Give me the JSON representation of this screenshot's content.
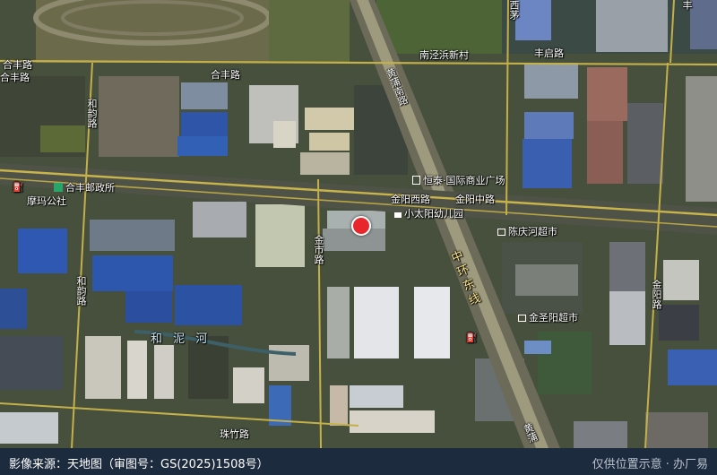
{
  "map": {
    "roads": {
      "hefeng_top_left": "合丰路",
      "hefeng_top_mid": "合丰路",
      "hefeng_left2": "合丰路",
      "fengqi": "丰启路",
      "fengqi_right": "丰启路",
      "huangcao": "黄蒲南路",
      "jinyang_west": "金阳西路",
      "jinyang_mid": "金阳中路",
      "zhonghuan": "中环东线",
      "heli_left": "和韵路",
      "heli_left2": "和韵路",
      "yuexi": "金市路",
      "zhuhe": "珠竹路",
      "right_road": "金阳路",
      "right_road2": "金阳路",
      "bottom_road": "黄蒲",
      "top_center_road": "西茅",
      "top_right_road": "丰"
    },
    "water": "和 泥 河",
    "pois": {
      "nanjing_village": "南泾浜新村",
      "hengtai": "恒泰·国际商业广场",
      "kindergarten": "小太阳幼儿园",
      "chenqinghe": "陈庆河超市",
      "jinshengyang": "金圣阳超市",
      "post_office": "合丰邮政所",
      "mama": "摩玛公社"
    }
  },
  "footer": {
    "source": "影像来源：天地图（审图号：GS(2025)1508号）",
    "disclaimer": "仅供位置示意 · 办厂易"
  },
  "colors": {
    "pin": "#e8262b",
    "footer_bg": "#1d2b3e"
  }
}
